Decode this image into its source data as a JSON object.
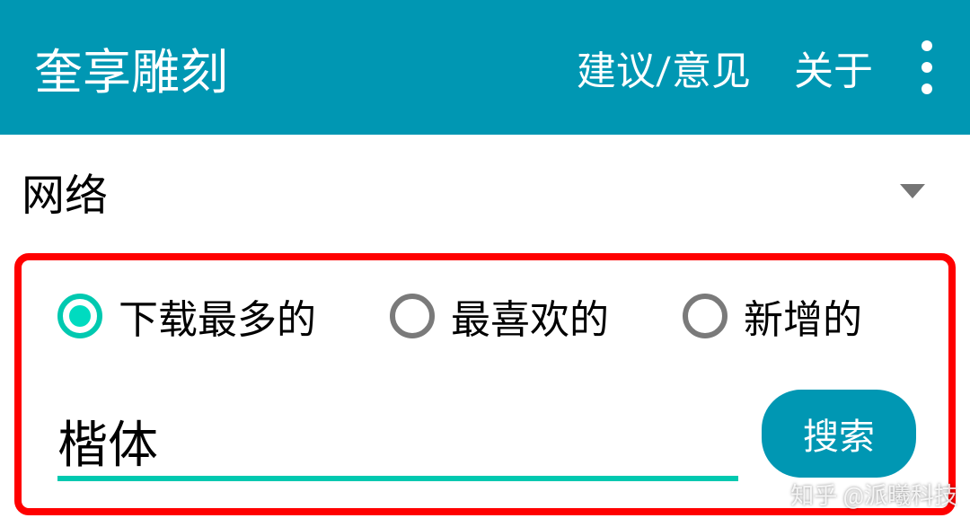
{
  "header": {
    "title": "奎享雕刻",
    "feedback_label": "建议/意见",
    "about_label": "关于"
  },
  "dropdown": {
    "selected_label": "网络"
  },
  "radios": {
    "option1": "下载最多的",
    "option2": "最喜欢的",
    "option3": "新增的"
  },
  "search": {
    "value": "楷体",
    "button_label": "搜索"
  },
  "watermark": "知乎 @派曦科技"
}
